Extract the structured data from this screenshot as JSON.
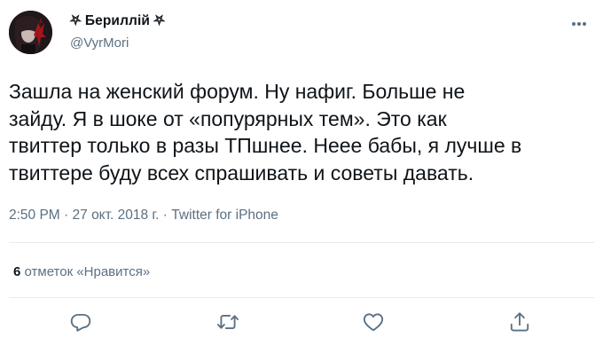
{
  "author": {
    "display_name": "⛧ Бериллій ⛧",
    "handle": "@VyrMori",
    "avatar_icon": "profile-photo-dark-red"
  },
  "tweet": {
    "lines": [
      "Зашла на женский форум. Ну нафиг. Больше не",
      "зайду. Я в шоке от «попурярных тем». Это как",
      "твиттер только в разы ТПшнее. Неее бабы, я лучше в",
      "твиттере буду всех спрашивать и советы давать."
    ],
    "time": "2:50 PM",
    "date": "27 окт. 2018 г.",
    "separator": " · ",
    "source": "Twitter for iPhone"
  },
  "stats": {
    "likes_count": "6",
    "likes_label": " отметок «Нравится»"
  },
  "actions": {
    "reply_icon": "reply-icon",
    "retweet_icon": "retweet-icon",
    "like_icon": "heart-icon",
    "share_icon": "share-icon",
    "more_icon": "more-options-icon"
  },
  "colors": {
    "text_primary": "#0f1419",
    "text_secondary": "#5b7083",
    "divider": "#e6ecf0",
    "background": "#ffffff"
  }
}
